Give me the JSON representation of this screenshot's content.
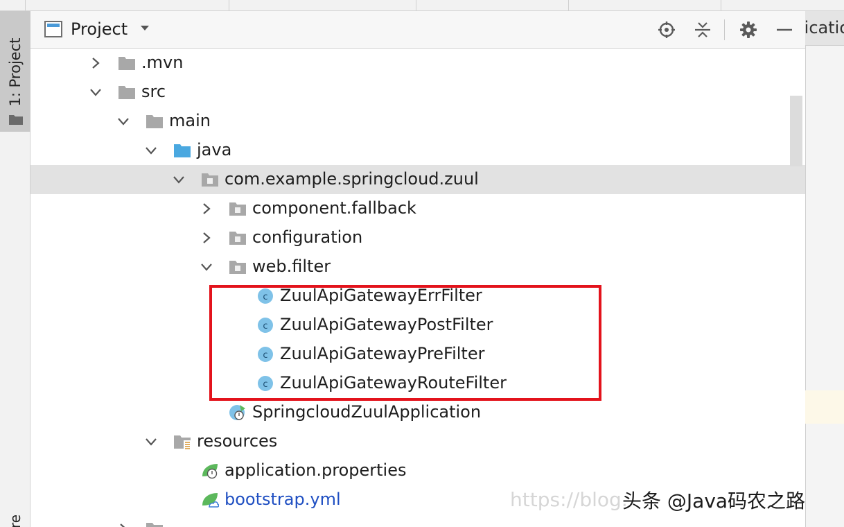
{
  "side_bar": {
    "project_tab": "1: Project",
    "bottom_tab_partial": "re"
  },
  "panel": {
    "title": "Project",
    "icons": [
      "project-view-icon",
      "chevron-down-icon",
      "locate-target-icon",
      "collapse-all-icon",
      "gear-icon",
      "minimize-icon"
    ]
  },
  "editor": {
    "tab_partial": "licatio"
  },
  "tree": [
    {
      "label": ".mvn",
      "icon": "folder-icon",
      "expanded": false
    },
    {
      "label": "src",
      "icon": "folder-icon",
      "expanded": true
    },
    {
      "label": "main",
      "icon": "folder-icon",
      "expanded": true
    },
    {
      "label": "java",
      "icon": "source-folder-icon",
      "expanded": true
    },
    {
      "label": "com.example.springcloud.zuul",
      "icon": "package-icon",
      "expanded": true,
      "selected": true
    },
    {
      "label": "component.fallback",
      "icon": "package-icon",
      "expanded": false
    },
    {
      "label": "configuration",
      "icon": "package-icon",
      "expanded": false
    },
    {
      "label": "web.filter",
      "icon": "package-icon",
      "expanded": true
    },
    {
      "label": "ZuulApiGatewayErrFilter",
      "icon": "class-icon"
    },
    {
      "label": "ZuulApiGatewayPostFilter",
      "icon": "class-icon"
    },
    {
      "label": "ZuulApiGatewayPreFilter",
      "icon": "class-icon"
    },
    {
      "label": "ZuulApiGatewayRouteFilter",
      "icon": "class-icon"
    },
    {
      "label": "SpringcloudZuulApplication",
      "icon": "spring-boot-class-icon"
    },
    {
      "label": "resources",
      "icon": "resources-folder-icon",
      "expanded": true
    },
    {
      "label": "application.properties",
      "icon": "spring-config-icon"
    },
    {
      "label": "bootstrap.yml",
      "icon": "spring-yaml-icon",
      "color": "#1f4fc2"
    },
    {
      "label": "",
      "icon": "folder-icon",
      "expanded": false
    }
  ],
  "colors": {
    "highlight_box": "#e3131c",
    "selection": "#e2e2e2",
    "class_icon": "#7fc2e8",
    "spring_green": "#5cb85c",
    "modified_blue": "#1f4fc2"
  },
  "watermark": {
    "light_text": "https://blog.",
    "dark_text": "头条 @Java码农之路"
  }
}
